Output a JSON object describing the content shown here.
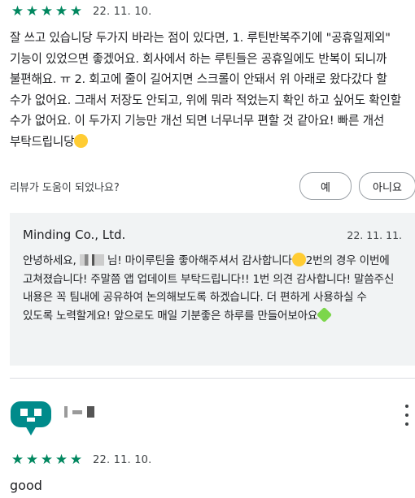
{
  "review1": {
    "stars": [
      "★",
      "★",
      "★",
      "★",
      "★"
    ],
    "rating": 5,
    "date": "22. 11. 10.",
    "text": "잘 쓰고 있습니당 두가지 바라는 점이 있다면, 1. 루틴반복주기에 \"공휴일제외\" 기능이 있었으면 좋겠어요. 회사에서 하는 루틴들은 공휴일에도 반복이 되니까 불편해요. ㅠ 2. 회고에 줄이 길어지면 스크롤이 안돼서 위 아래로 왔다갔다 할 수가 없어요. 그래서 저장도 안되고, 위에 뭐라 적었는지 확인 하고 싶어도 확인할 수가 없어요. 이 두가지 기능만 개선 되면 너무너무 편할 것 같아요! 빠른 개선 부탁드립니당",
    "emoji": "grinning-face"
  },
  "helpful": {
    "question": "리뷰가 도움이 되었나요?",
    "yes_label": "예",
    "no_label": "아니요"
  },
  "developer_reply": {
    "author": "Minding Co., Ltd.",
    "date": "22. 11. 11.",
    "text_part1": "안녕하세요,",
    "text_part2": "님! 마이루틴을 좋아해주셔서 감사합니다",
    "text_part3": "2번의 경우 이번에 고쳐졌습니다! 주말쯤 앱 업데이트 부탁드립니다!! 1번 의견 감사합니다! 말씀주신 내용은 꼭 팀내에 공유하여 논의해보도록 하겠습니다. 더 편하게 사용하실 수 있도록 노력할게요! 앞으로도 매일 기분좋은 하루를 만들어보아요",
    "emoji1": "smiling-face",
    "emoji2": "green-heart"
  },
  "review2": {
    "avatar_icon": "chat-bubble-avatar-icon",
    "avatar_color": "#008b8b",
    "more_icon": "more-vert-icon",
    "stars": [
      "★",
      "★",
      "★",
      "★",
      "★"
    ],
    "rating": 5,
    "date": "22. 11. 10.",
    "text": "good"
  },
  "colors": {
    "star": "#01875f",
    "reply_bg": "#f1f3f4",
    "button_border": "#9aa0a6"
  }
}
